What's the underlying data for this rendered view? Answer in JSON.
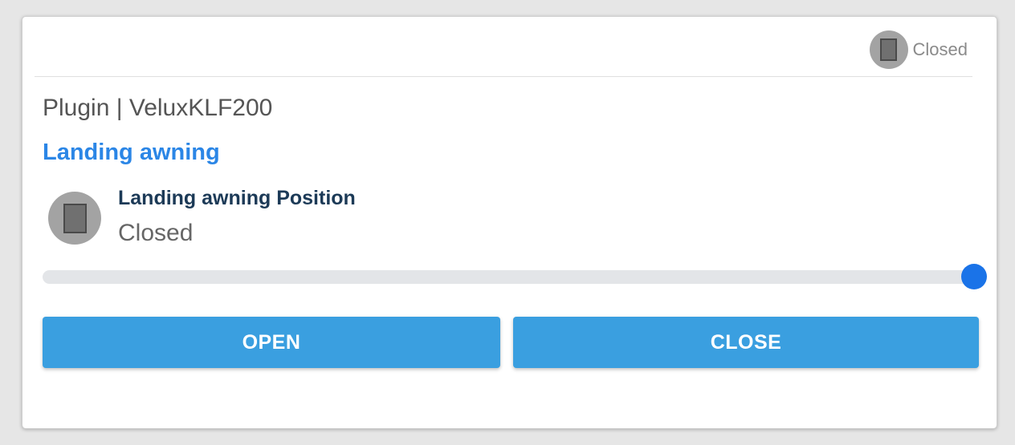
{
  "header": {
    "status_icon": "door-closed-icon",
    "status_label": "Closed"
  },
  "plugin": {
    "label": "Plugin | VeluxKLF200"
  },
  "device": {
    "title": "Landing awning",
    "state_icon": "door-closed-icon",
    "state_name": "Landing awning Position",
    "state_value": "Closed"
  },
  "slider": {
    "value_fraction": 1.0,
    "accent_color": "#1a73e8"
  },
  "buttons": {
    "open_label": "OPEN",
    "close_label": "CLOSE",
    "color": "#3a9fe0"
  },
  "colors": {
    "title": "#2b86e6",
    "state_name": "#1c3a57"
  }
}
